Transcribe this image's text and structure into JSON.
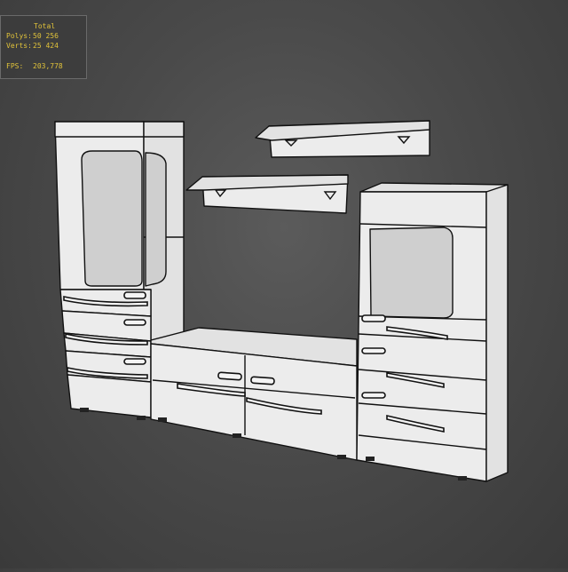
{
  "stats": {
    "header": "Total",
    "rows": [
      {
        "label": "Polys:",
        "value": "50 256"
      },
      {
        "label": "Verts:",
        "value": "25 424"
      },
      {
        "label": "FPS:",
        "value": "203,778"
      }
    ]
  },
  "viewport": {
    "background_color": "#4a4a4a",
    "model_color": "#ececec",
    "wire_color": "#111111",
    "overlay_text_color": "#e0c23a"
  }
}
